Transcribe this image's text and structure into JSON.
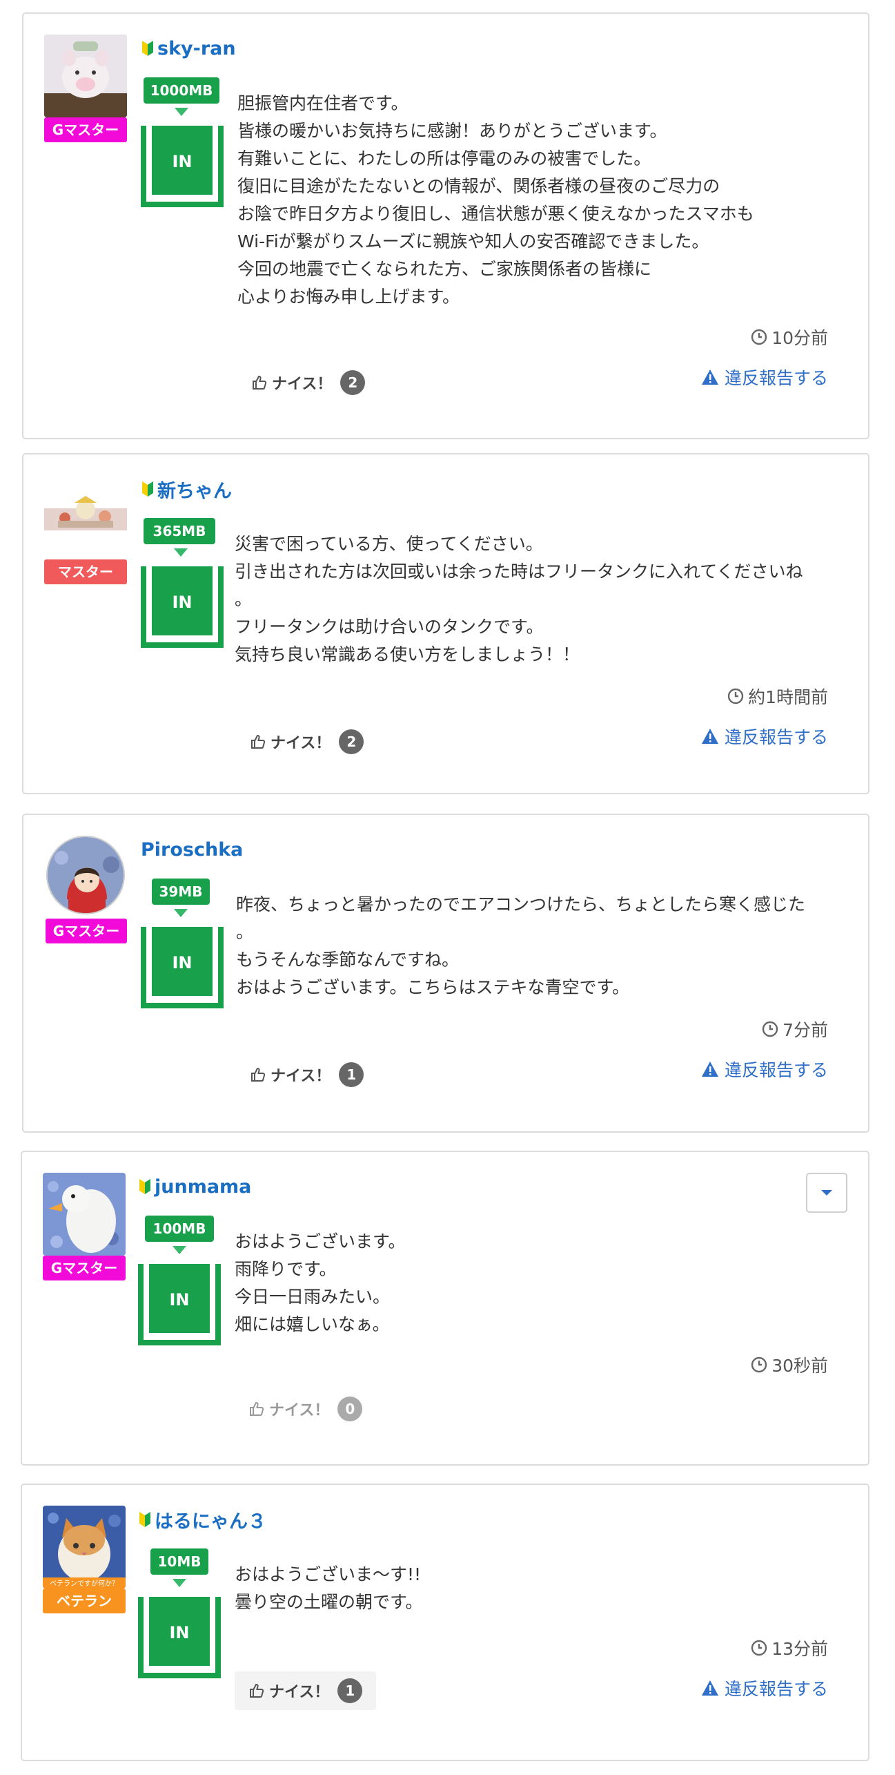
{
  "common": {
    "nice_label": "ナイス！",
    "report_label": "違反報告する",
    "in_label": "IN"
  },
  "posts": [
    {
      "username": "sky-ran",
      "rank": "Gマスター",
      "rank_color": "#f20ad8",
      "mb": "1000MB",
      "text": "胆振管内在住者です。\n皆様の暖かいお気持ちに感謝！ありがとうございます。\n有難いことに、わたしの所は停電のみの被害でした。\n復旧に目途がたたないとの情報が、関係者様の昼夜のご尽力の\nお陰で昨日夕方より復旧し、通信状態が悪く使えなかったスマホも\nWi-Fiが繋がりスムーズに親族や知人の安否確認できました。\n今回の地震で亡くなられた方、ご家族関係者の皆様に\n心よりお悔み申し上げます。",
      "time": "10分前",
      "nice_count": "2"
    },
    {
      "username": "新ちゃん",
      "rank": "マスター",
      "rank_color": "#f05a5a",
      "mb": "365MB",
      "text": "災害で困っている方、使ってください。\n引き出された方は次回或いは余った時はフリータンクに入れてくださいね\n。\nフリータンクは助け合いのタンクです。\n気持ち良い常識ある使い方をしましょう！！",
      "time": "約1時間前",
      "nice_count": "2"
    },
    {
      "username": "Piroschka",
      "rank": "Gマスター",
      "rank_color": "#f20ad8",
      "mb": "39MB",
      "text": "昨夜、ちょっと暑かったのでエアコンつけたら、ちょとしたら寒く感じた\n。\nもうそんな季節なんですね。\nおはようございます。こちらはステキな青空です。",
      "time": "7分前",
      "nice_count": "1"
    },
    {
      "username": "junmama",
      "rank": "Gマスター",
      "rank_color": "#f20ad8",
      "mb": "100MB",
      "text": "おはようございます。\n雨降りです。\n今日一日雨みたい。\n畑には嬉しいなぁ。",
      "time": "30秒前",
      "nice_count": "0"
    },
    {
      "username": "はるにゃん３",
      "rank": "ベテラン",
      "rank_color": "#f7931e",
      "avatar_caption": "ベテランですが何か？",
      "mb": "10MB",
      "text": "おはようございま〜す!!\n曇り空の土曜の朝です。",
      "time": "13分前",
      "nice_count": "1"
    }
  ]
}
